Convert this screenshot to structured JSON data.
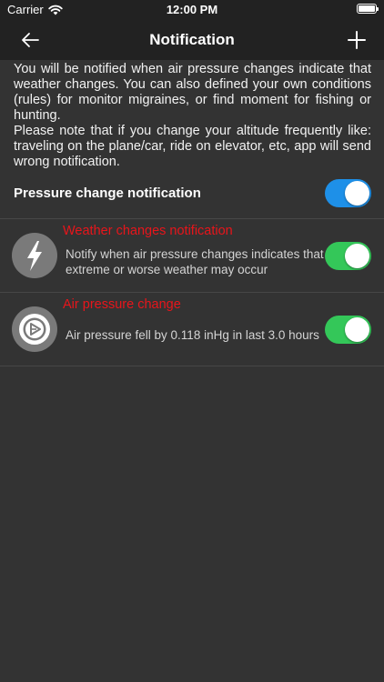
{
  "status_bar": {
    "carrier": "Carrier",
    "time": "12:00 PM"
  },
  "nav": {
    "title": "Notification",
    "back_icon": "arrow-left-icon",
    "add_icon": "plus-icon"
  },
  "intro": {
    "paragraph1": "You will be notified when air pressure changes indicate that weather changes. You can also defined your own conditions (rules) for monitor migraines, or find moment for fishing or hunting.",
    "paragraph2": "Please note that if you change your altitude frequently like: traveling on the plane/car, ride on elevator, etc, app will send wrong notification."
  },
  "main_toggle": {
    "label": "Pressure change notification",
    "on": true,
    "color": "#1e90e8"
  },
  "rules": [
    {
      "title": "Weather changes notification",
      "description": "Notify when air pressure changes indicates that extreme or worse weather may occur",
      "icon": "lightning-bolt-icon",
      "on": true
    },
    {
      "title": "Air pressure change",
      "description": "Air pressure fell by 0.118 inHg in last 3.0 hours",
      "icon": "pressure-gauge-icon",
      "on": true
    }
  ],
  "colors": {
    "background": "#333333",
    "bar": "#222222",
    "rule_title": "#e8151b",
    "rule_toggle": "#34c759",
    "icon_circle": "#7a7a7a"
  }
}
